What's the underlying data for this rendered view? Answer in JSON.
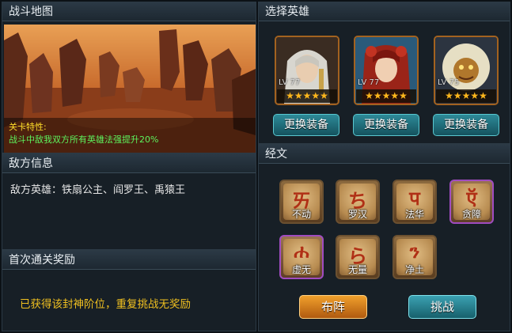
{
  "map": {
    "header": "战斗地图",
    "feature_title": "关卡特性:",
    "feature_text": "战斗中敌我双方所有英雄法强提升20%"
  },
  "enemy": {
    "header": "敌方信息",
    "text": "敌方英雄：铁扇公主、阎罗王、禹猿王"
  },
  "reward": {
    "header": "首次通关奖励",
    "text": "已获得该封神阶位，重复挑战无奖励"
  },
  "heroes": {
    "header": "选择英雄",
    "list": [
      {
        "level": "LV 77",
        "stars": "★★★★★",
        "equip_label": "更换装备",
        "portrait": "white-hair-goddess"
      },
      {
        "level": "LV 77",
        "stars": "★★★★★",
        "equip_label": "更换装备",
        "portrait": "red-hair-girl"
      },
      {
        "level": "LV 75",
        "stars": "★★★★★",
        "equip_label": "更换装备",
        "portrait": "lion-beast-warrior"
      }
    ]
  },
  "scriptures": {
    "header": "经文",
    "items": [
      {
        "name": "不动",
        "glyph": "ㄞ",
        "frame": "brown"
      },
      {
        "name": "罗汉",
        "glyph": "ち",
        "frame": "brown"
      },
      {
        "name": "法华",
        "glyph": "प",
        "frame": "brown"
      },
      {
        "name": "贪障",
        "glyph": "ऍ",
        "frame": "purple"
      },
      {
        "name": "虚无",
        "glyph": "ሐ",
        "frame": "purple"
      },
      {
        "name": "无量",
        "glyph": "ら",
        "frame": "brown"
      },
      {
        "name": "净土",
        "glyph": "ን",
        "frame": "brown"
      }
    ]
  },
  "actions": {
    "formation_label": "布阵",
    "challenge_label": "挑战"
  }
}
